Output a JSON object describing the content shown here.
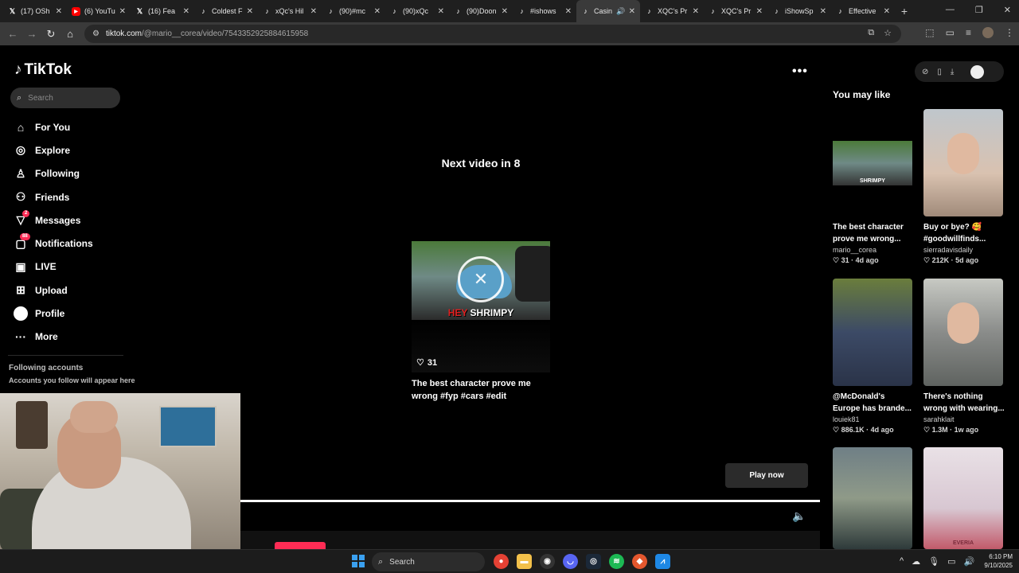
{
  "browser": {
    "tabs": [
      {
        "icon": "x-icon",
        "title": "(17) OSh"
      },
      {
        "icon": "youtube-icon",
        "title": "(6) YouTu"
      },
      {
        "icon": "x-icon",
        "title": "(16) Fea"
      },
      {
        "icon": "tiktok-icon",
        "title": "Coldest F"
      },
      {
        "icon": "tiktok-icon",
        "title": "xQc's Hil"
      },
      {
        "icon": "tiktok-icon",
        "title": "(90)#mc"
      },
      {
        "icon": "tiktok-icon",
        "title": "(90)xQc"
      },
      {
        "icon": "tiktok-icon",
        "title": "(90)Doon"
      },
      {
        "icon": "tiktok-icon",
        "title": "#ishows"
      },
      {
        "icon": "tiktok-icon",
        "title": "Casin"
      },
      {
        "icon": "tiktok-icon",
        "title": "XQC's Pr"
      },
      {
        "icon": "tiktok-icon",
        "title": "XQC's Pr"
      },
      {
        "icon": "tiktok-icon",
        "title": "iShowSp"
      },
      {
        "icon": "tiktok-icon",
        "title": "Effective"
      }
    ],
    "active_tab_index": 9,
    "url_host": "tiktok.com",
    "url_path": "/@mario__corea/video/7543352925884615958"
  },
  "tiktok": {
    "logo_text": "TikTok",
    "search_placeholder": "Search",
    "nav": [
      {
        "icon": "home-icon",
        "label": "For You"
      },
      {
        "icon": "compass-icon",
        "label": "Explore"
      },
      {
        "icon": "following-icon",
        "label": "Following"
      },
      {
        "icon": "friends-icon",
        "label": "Friends"
      },
      {
        "icon": "messages-icon",
        "label": "Messages",
        "badge": "2"
      },
      {
        "icon": "notifications-icon",
        "label": "Notifications",
        "badge": "88"
      },
      {
        "icon": "live-icon",
        "label": "LIVE"
      },
      {
        "icon": "upload-icon",
        "label": "Upload"
      },
      {
        "icon": "profile-icon",
        "label": "Profile"
      },
      {
        "icon": "more-icon",
        "label": "More"
      }
    ],
    "following_accounts_title": "Following accounts",
    "following_accounts_sub": "Accounts you follow will appear here",
    "player": {
      "next_video_label": "Next video in 8",
      "thumb_caption_red": "HEY",
      "thumb_caption_white": " SHRIMPY",
      "likes": "31",
      "title": "The best character prove me wrong #fyp #cars #edit",
      "play_now_label": "Play now",
      "more_glyph": "•••"
    },
    "you_may_like_title": "You may like",
    "recommendations": [
      {
        "title": "The best character prove me wrong...",
        "author": "mario__corea",
        "likes": "31",
        "age": "4d ago",
        "thumb_caption": "SHRIMPY"
      },
      {
        "title": "Buy or bye? 🥰 #goodwillfinds...",
        "author": "sierradavisdaily",
        "likes": "212K",
        "age": "5d ago"
      },
      {
        "title": "@McDonald's Europe has brande...",
        "author": "louiek81",
        "likes": "886.1K",
        "age": "4d ago"
      },
      {
        "title": "There's nothing wrong with wearing...",
        "author": "sarahklait",
        "likes": "1.3M",
        "age": "1w ago"
      },
      {
        "title": "",
        "author": "",
        "likes": "",
        "age": ""
      },
      {
        "title": "",
        "author": "",
        "likes": "",
        "age": "",
        "thumb_caption": "EVERIA"
      }
    ]
  },
  "taskbar": {
    "search_label": "Search",
    "time": "6:10 PM",
    "date": "9/10/2025",
    "app_icons": [
      "chrome-icon",
      "file-explorer-icon",
      "obs-icon",
      "discord-icon",
      "steam-icon",
      "spotify-icon",
      "game-icon",
      "app-icon"
    ]
  },
  "colors": {
    "tiktok_red": "#fe2c55",
    "page_bg": "#000000",
    "chrome_bg": "#1f1f1f"
  }
}
